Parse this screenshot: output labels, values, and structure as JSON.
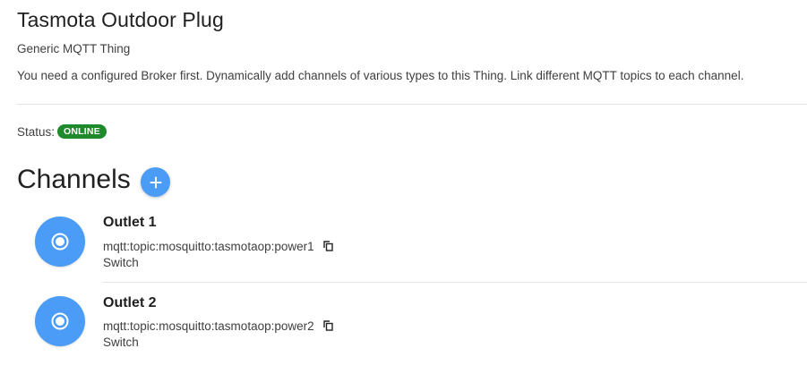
{
  "thing": {
    "title": "Tasmota Outdoor Plug",
    "subtitle": "Generic MQTT Thing",
    "description": "You need a configured Broker first. Dynamically add channels of various types to this Thing. Link different MQTT topics to each channel."
  },
  "status": {
    "label": "Status:",
    "badge": "ONLINE",
    "badge_color": "#1f8a2c"
  },
  "channels": {
    "title": "Channels",
    "add_icon": "plus-icon",
    "accent_color": "#4a9cf7",
    "items": [
      {
        "label": "Outlet 1",
        "uid": "mqtt:topic:mosquitto:tasmotaop:power1",
        "type": "Switch",
        "icon": "radio-button-icon",
        "copy_icon": "copy-icon"
      },
      {
        "label": "Outlet 2",
        "uid": "mqtt:topic:mosquitto:tasmotaop:power2",
        "type": "Switch",
        "icon": "radio-button-icon",
        "copy_icon": "copy-icon"
      }
    ]
  }
}
